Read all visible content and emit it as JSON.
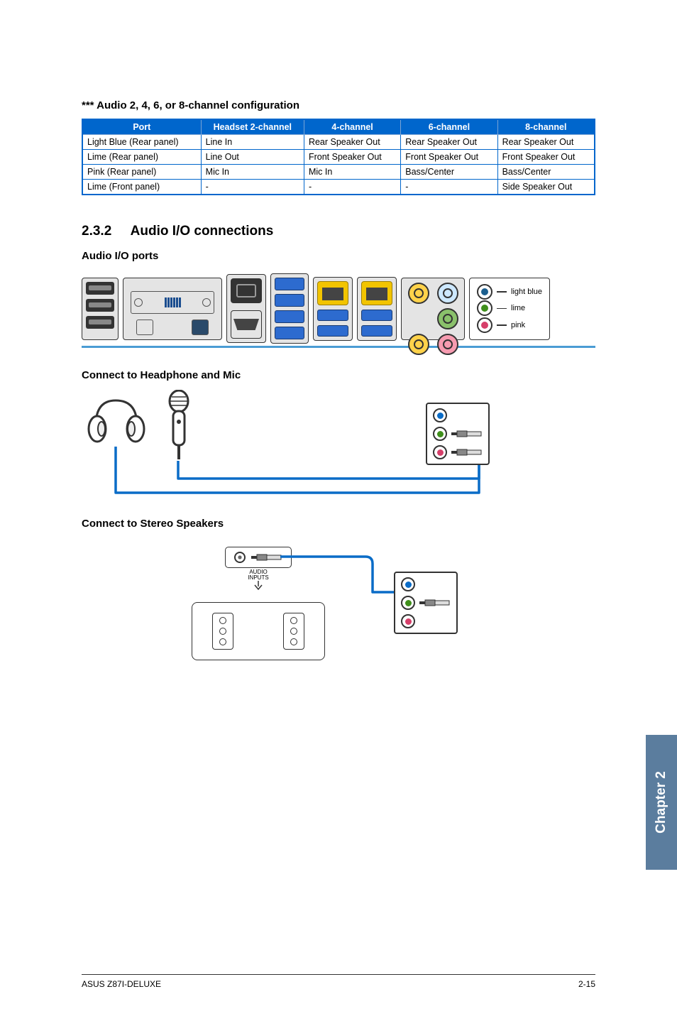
{
  "config_title": "*** Audio 2, 4, 6, or 8-channel configuration",
  "table": {
    "headers": [
      "Port",
      "Headset 2-channel",
      "4-channel",
      "6-channel",
      "8-channel"
    ],
    "rows": [
      [
        "Light Blue (Rear panel)",
        "Line In",
        "Rear Speaker Out",
        "Rear Speaker Out",
        "Rear Speaker Out"
      ],
      [
        "Lime (Rear panel)",
        "Line Out",
        "Front Speaker Out",
        "Front Speaker Out",
        "Front Speaker Out"
      ],
      [
        "Pink (Rear panel)",
        "Mic In",
        "Mic In",
        "Bass/Center",
        "Bass/Center"
      ],
      [
        "Lime (Front panel)",
        "-",
        "-",
        "-",
        "Side Speaker Out"
      ]
    ]
  },
  "section": {
    "num": "2.3.2",
    "title": "Audio I/O connections"
  },
  "sub1": "Audio I/O ports",
  "legend": {
    "lb": "light blue",
    "lime": "lime",
    "pink": "pink"
  },
  "sub2": "Connect to Headphone and Mic",
  "sub3": "Connect to Stereo Speakers",
  "amp": {
    "label1": "AUDIO",
    "label2": "INPUTS"
  },
  "footer": {
    "left": "ASUS Z87I-DELUXE",
    "right": "2-15"
  },
  "chapter": "Chapter 2"
}
